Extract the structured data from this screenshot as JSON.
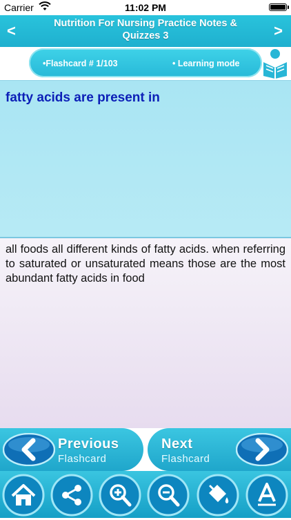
{
  "status_bar": {
    "carrier": "Carrier",
    "time": "11:02 PM"
  },
  "header": {
    "title": "Nutrition For Nursing Practice Notes & Quizzes 3",
    "back_glyph": "<",
    "forward_glyph": ">"
  },
  "info_bar": {
    "flashcard_label": "•Flashcard #  1/103",
    "mode_label": "• Learning mode"
  },
  "card": {
    "question": "fatty acids are present in",
    "answer": "all foods all different kinds of fatty acids. when referring to saturated or unsaturated means those are the most abundant fatty acids in food"
  },
  "flashcard_nav": {
    "previous_line1": "Previous",
    "previous_line2": "Flashcard",
    "next_line1": "Next",
    "next_line2": "Flashcard"
  },
  "toolbar": {
    "items": [
      "home-icon",
      "share-icon",
      "zoom-in-icon",
      "zoom-out-icon",
      "paint-bucket-icon",
      "font-icon"
    ]
  },
  "colors": {
    "accent": "#1fb0cf",
    "question_text": "#0c1fb7",
    "question_bg": "#a9e5f3",
    "answer_bg": "#ece3f3"
  }
}
